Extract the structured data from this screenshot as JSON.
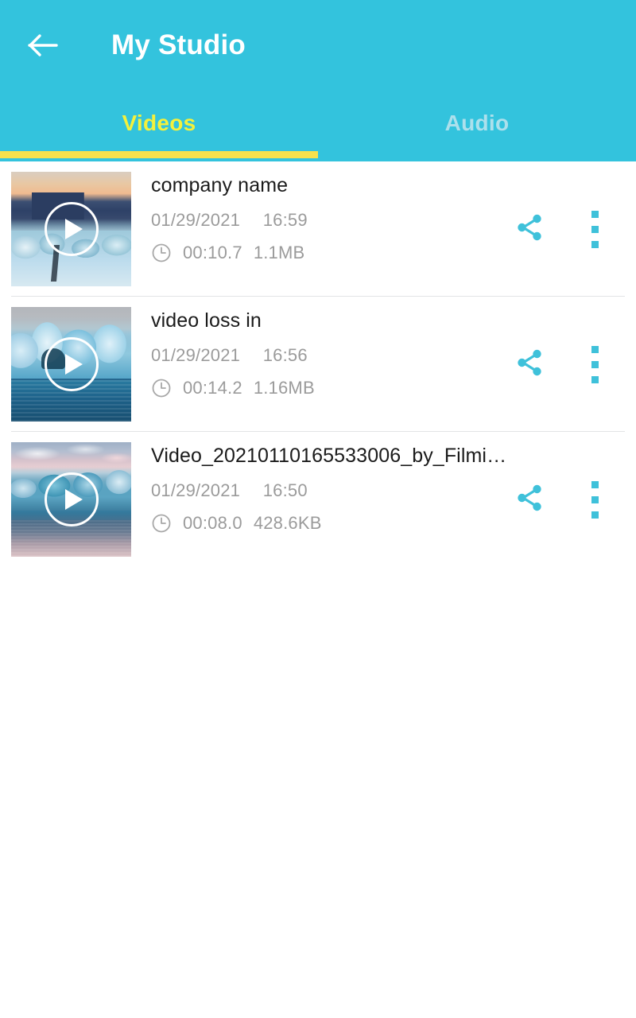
{
  "header": {
    "title": "My Studio",
    "back_icon": "arrow-left-icon",
    "background_color": "#33c3dd",
    "title_color": "#ffffff"
  },
  "tabs": {
    "items": [
      {
        "label": "Videos",
        "selected": true,
        "color": "#f4f13c"
      },
      {
        "label": "Audio",
        "selected": false,
        "color": "#ace0ec"
      }
    ],
    "indicator_color": "#f6e14c"
  },
  "list": {
    "items": [
      {
        "title": "company name",
        "date": "01/29/2021",
        "time": "16:59",
        "duration": "00:10.7",
        "size": "1.1MB",
        "play_icon": "play-icon",
        "clock_icon": "clock-icon",
        "share_icon": "share-icon",
        "more_icon": "more-vertical-icon"
      },
      {
        "title": "video loss in",
        "date": "01/29/2021",
        "time": "16:56",
        "duration": "00:14.2",
        "size": "1.16MB",
        "play_icon": "play-icon",
        "clock_icon": "clock-icon",
        "share_icon": "share-icon",
        "more_icon": "more-vertical-icon"
      },
      {
        "title": "Video_20210110165533006_by_Filmi…",
        "date": "01/29/2021",
        "time": "16:50",
        "duration": "00:08.0",
        "size": "428.6KB",
        "play_icon": "play-icon",
        "clock_icon": "clock-icon",
        "share_icon": "share-icon",
        "more_icon": "more-vertical-icon"
      }
    ],
    "accent_color": "#3fc1da",
    "meta_text_color": "#9b9b9b",
    "title_text_color": "#1b1b1b"
  }
}
